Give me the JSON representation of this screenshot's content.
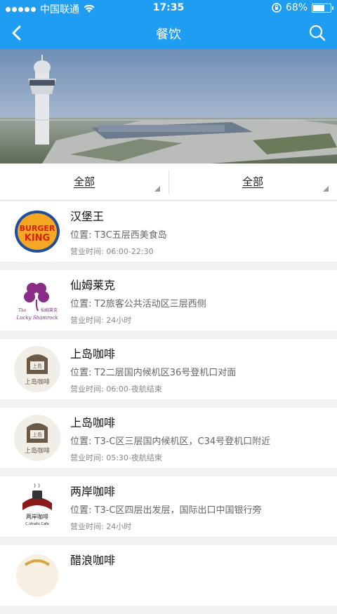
{
  "status_bar": {
    "carrier": "中国联通",
    "time": "17:35",
    "battery": "68%",
    "battery_level": 0.68
  },
  "nav": {
    "title": "餐饮",
    "back_icon": "chevron-left-icon",
    "search_icon": "search-icon"
  },
  "filters": [
    {
      "label": "全部"
    },
    {
      "label": "全部"
    }
  ],
  "restaurants": [
    {
      "name": "汉堡王",
      "location": "位置: T3C五层西美食岛",
      "hours": "营业时间: 06:00-22:30",
      "logo_text": [
        "BURGER",
        "KING"
      ]
    },
    {
      "name": "仙姆莱克",
      "location": "位置: T2旅客公共活动区三层西侧",
      "hours": "营业时间: 24小时",
      "logo_text": [
        "The",
        "仙姆莱克",
        "Lucky Shamrock"
      ]
    },
    {
      "name": "上岛咖啡",
      "location": "位置: T2二层国内候机区36号登机口对面",
      "hours": "营业时间: 06:00-夜航结束",
      "logo_text": [
        "上岛咖啡"
      ]
    },
    {
      "name": "上岛咖啡",
      "location": "位置: T3-C区三层国内候机区，C34号登机口附近",
      "hours": "营业时间: 05:30-夜航结束",
      "logo_text": [
        "上岛咖啡"
      ]
    },
    {
      "name": "两岸咖啡",
      "location": "位置: T3-C区四层出发层，国际出口中国银行旁",
      "hours": "营业时间: 24小时",
      "logo_text": [
        "两岸咖啡",
        "C.straits Cafe"
      ]
    },
    {
      "name": "醋浪咖啡"
    }
  ]
}
